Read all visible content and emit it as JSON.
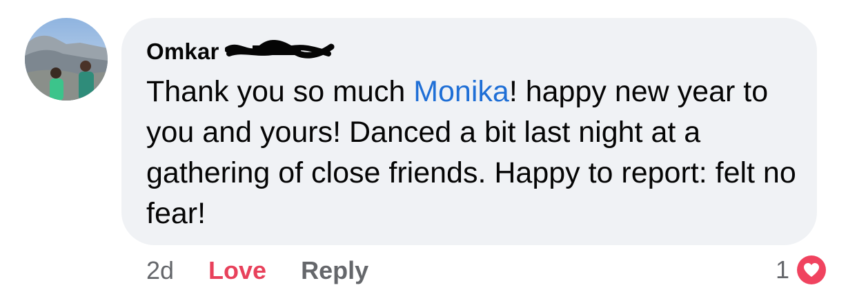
{
  "comment": {
    "author": "Omkar",
    "text_before": "Thank you so much ",
    "mention": "Monika",
    "text_after": "! happy new year to you and yours! Danced a bit last night at a gathering of close friends. Happy to report: felt no fear!"
  },
  "actions": {
    "time": "2d",
    "love_label": "Love",
    "reply_label": "Reply"
  },
  "reactions": {
    "count": "1",
    "icon": "heart-icon",
    "color": "#f0435f"
  },
  "colors": {
    "bubble": "#f0f2f5",
    "mention": "#1f6fd6",
    "love": "#e8415b",
    "muted": "#65676b"
  }
}
